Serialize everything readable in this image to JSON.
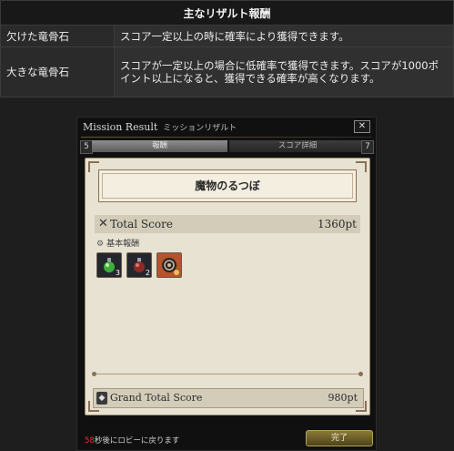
{
  "table": {
    "header": "主なリザルト報酬",
    "rows": [
      {
        "name": "欠けた竜骨石",
        "desc": "スコア一定以上の時に確率により獲得できます。"
      },
      {
        "name": "大きな竜骨石",
        "desc": "スコアが一定以上の場合に低確率で獲得できます。スコアが1000ポイント以上になると、獲得できる確率が高くなります。"
      }
    ]
  },
  "window": {
    "title": "Mission Result",
    "title_jp": "ミッションリザルト",
    "close_label": "✕",
    "tabs": {
      "left_num": "5",
      "right_num": "7",
      "tab1": "報酬",
      "tab2": "スコア詳細"
    },
    "banner": "魔物のるつぼ",
    "total_score": {
      "label": "Total Score",
      "value": "1360pt"
    },
    "basic_reward_label": "基本報酬",
    "items": [
      {
        "icon": "green-potion-icon",
        "count": "3"
      },
      {
        "icon": "red-potion-icon",
        "count": "2"
      },
      {
        "icon": "shell-icon",
        "count": ""
      }
    ],
    "grand_total": {
      "label": "Grand Total Score",
      "value": "980pt"
    },
    "footer": {
      "seconds": "58",
      "message": "秒後にロビーに戻ります"
    },
    "done_label": "完了"
  },
  "colors": {
    "background": "#1e1e1e",
    "panel": "#e7e2d2",
    "accent_brown": "#8b6f55",
    "countdown_red": "#e0362c",
    "done_button": "#8a7a38"
  }
}
